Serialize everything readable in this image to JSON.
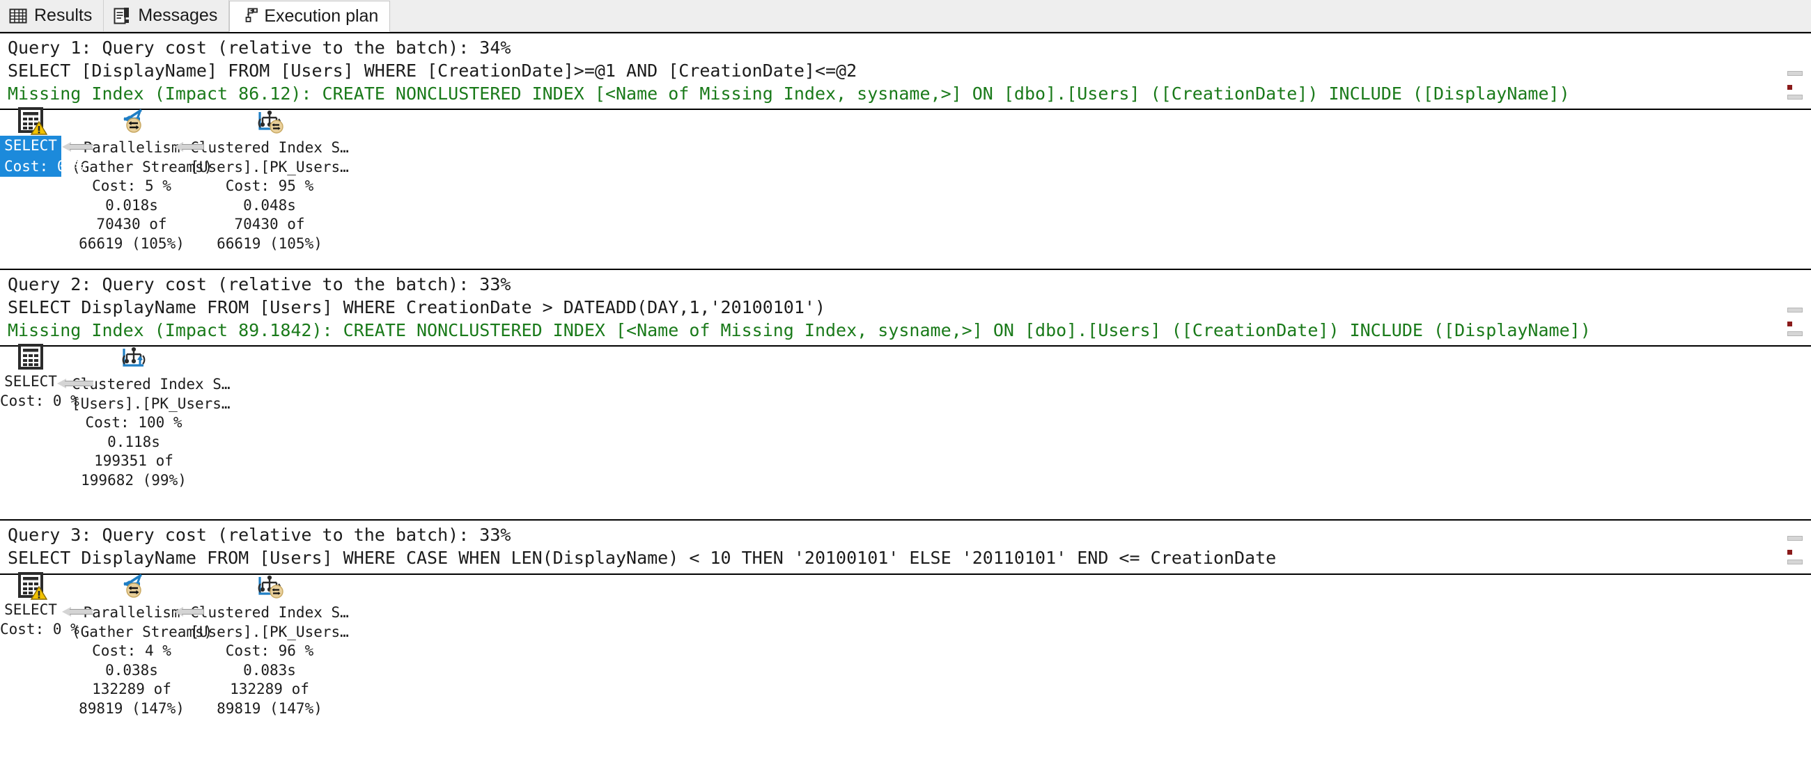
{
  "tabs": [
    {
      "label": "Results",
      "icon": "grid-icon",
      "active": false
    },
    {
      "label": "Messages",
      "icon": "message-list-icon",
      "active": false
    },
    {
      "label": "Execution plan",
      "icon": "execution-plan-icon",
      "active": true
    }
  ],
  "colors": {
    "missing_index_green": "#1a7a1a",
    "selection_blue": "#1c8adb",
    "warning_yellow": "#f2c200",
    "parallelism_gold": "#e8cf9a",
    "index_blue": "#1f7ec4",
    "arrow_gray": "#d4d4d4"
  },
  "queries": [
    {
      "header": "Query 1: Query cost (relative to the batch): 34%",
      "sql": "SELECT [DisplayName] FROM [Users] WHERE [CreationDate]>=@1 AND [CreationDate]<=@2",
      "missing_index": "Missing Index (Impact 86.12): CREATE NONCLUSTERED INDEX [<Name of Missing Index, sysname,>] ON [dbo].[Users] ([CreationDate]) INCLUDE ([DisplayName])",
      "nodes": [
        {
          "name": "select-node",
          "icon": "result-grid-icon",
          "warning": true,
          "selected": true,
          "lines": [
            "SELECT",
            "Cost: 0 %"
          ]
        },
        {
          "name": "parallelism-node",
          "icon": "parallelism-gather-streams-icon",
          "warning": false,
          "selected": false,
          "lines": [
            "Parallelism",
            "(Gather Streams)",
            "Cost: 5 %",
            "0.018s",
            "70430 of",
            "66619 (105%)"
          ]
        },
        {
          "name": "clustered-index-scan-node",
          "icon": "clustered-index-scan-parallel-icon",
          "warning": false,
          "selected": false,
          "lines": [
            "Clustered Index S…",
            "[Users].[PK_Users…",
            "Cost: 95 %",
            "0.048s",
            "70430 of",
            "66619 (105%)"
          ]
        }
      ]
    },
    {
      "header": "Query 2: Query cost (relative to the batch): 33%",
      "sql": "SELECT DisplayName FROM [Users] WHERE CreationDate > DATEADD(DAY,1,'20100101')",
      "missing_index": "Missing Index (Impact 89.1842): CREATE NONCLUSTERED INDEX [<Name of Missing Index, sysname,>] ON [dbo].[Users] ([CreationDate]) INCLUDE ([DisplayName])",
      "nodes": [
        {
          "name": "select-node",
          "icon": "result-grid-icon",
          "warning": false,
          "selected": false,
          "lines": [
            "SELECT",
            "Cost: 0 %"
          ]
        },
        {
          "name": "clustered-index-scan-node",
          "icon": "clustered-index-scan-icon",
          "warning": false,
          "selected": false,
          "lines": [
            "Clustered Index S…",
            "[Users].[PK_Users…",
            "Cost: 100 %",
            "0.118s",
            "199351 of",
            "199682 (99%)"
          ]
        }
      ]
    },
    {
      "header": "Query 3: Query cost (relative to the batch): 33%",
      "sql": "SELECT DisplayName FROM [Users] WHERE CASE WHEN LEN(DisplayName) < 10 THEN '20100101' ELSE '20110101' END <= CreationDate",
      "missing_index": null,
      "nodes": [
        {
          "name": "select-node",
          "icon": "result-grid-icon",
          "warning": true,
          "selected": false,
          "lines": [
            "SELECT",
            "Cost: 0 %"
          ]
        },
        {
          "name": "parallelism-node",
          "icon": "parallelism-gather-streams-icon",
          "warning": false,
          "selected": false,
          "lines": [
            "Parallelism",
            "(Gather Streams)",
            "Cost: 4 %",
            "0.038s",
            "132289 of",
            "89819 (147%)"
          ]
        },
        {
          "name": "clustered-index-scan-node",
          "icon": "clustered-index-scan-parallel-icon",
          "warning": false,
          "selected": false,
          "lines": [
            "Clustered Index S…",
            "[Users].[PK_Users…",
            "Cost: 96 %",
            "0.083s",
            "132289 of",
            "89819 (147%)"
          ]
        }
      ]
    }
  ]
}
